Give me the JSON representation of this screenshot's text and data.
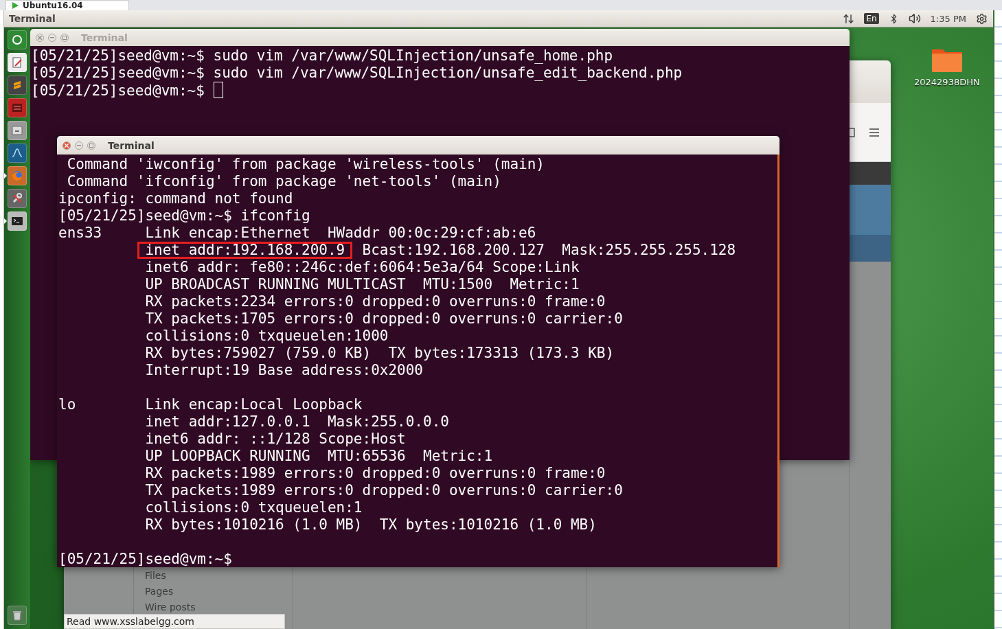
{
  "host_tab": {
    "label": "Ubuntu16.04"
  },
  "top_panel": {
    "app_title": "Terminal",
    "keyboard": "En",
    "clock": "1:35 PM"
  },
  "launcher": {
    "items": [
      {
        "kind": "home",
        "running": false
      },
      {
        "kind": "editor",
        "running": false
      },
      {
        "kind": "sublime",
        "running": false
      },
      {
        "kind": "calculator",
        "running": false
      },
      {
        "kind": "archive",
        "running": false
      },
      {
        "kind": "wave",
        "running": false
      },
      {
        "kind": "browser",
        "running": true
      },
      {
        "kind": "tools",
        "running": false
      },
      {
        "kind": "terminal",
        "running": true
      }
    ],
    "trash": {
      "kind": "trash"
    }
  },
  "desktop_icons": [
    {
      "label": "20242938DHN"
    }
  ],
  "browser": {
    "sidebar": [
      "Files",
      "Pages",
      "Wire posts"
    ],
    "status": "Read www.xsslabelgg.com"
  },
  "back_terminal": {
    "title": "Terminal",
    "focused": false,
    "cursor": true,
    "lines": [
      "[05/21/25]seed@vm:~$ sudo vim /var/www/SQLInjection/unsafe_home.php",
      "[05/21/25]seed@vm:~$ sudo vim /var/www/SQLInjection/unsafe_edit_backend.php",
      "[05/21/25]seed@vm:~$ "
    ]
  },
  "front_terminal": {
    "title": "Terminal",
    "focused": true,
    "lines": [
      {
        "kind": "plain",
        "text": " Command 'iwconfig' from package 'wireless-tools' (main)"
      },
      {
        "kind": "plain",
        "text": " Command 'ifconfig' from package 'net-tools' (main)"
      },
      {
        "kind": "plain",
        "text": "ipconfig: command not found"
      },
      {
        "kind": "plain",
        "text": "[05/21/25]seed@vm:~$ ifconfig"
      },
      {
        "kind": "plain",
        "text": "ens33     Link encap:Ethernet  HWaddr 00:0c:29:cf:ab:e6"
      },
      {
        "kind": "boxed",
        "boxed": "inet addr:192.168.200.9",
        "post": "  Bcast:192.168.200.127  Mask:255.255.255.128"
      },
      {
        "kind": "plain",
        "text": "          inet6 addr: fe80::246c:def:6064:5e3a/64 Scope:Link"
      },
      {
        "kind": "plain",
        "text": "          UP BROADCAST RUNNING MULTICAST  MTU:1500  Metric:1"
      },
      {
        "kind": "plain",
        "text": "          RX packets:2234 errors:0 dropped:0 overruns:0 frame:0"
      },
      {
        "kind": "plain",
        "text": "          TX packets:1705 errors:0 dropped:0 overruns:0 carrier:0"
      },
      {
        "kind": "plain",
        "text": "          collisions:0 txqueuelen:1000"
      },
      {
        "kind": "plain",
        "text": "          RX bytes:759027 (759.0 KB)  TX bytes:173313 (173.3 KB)"
      },
      {
        "kind": "plain",
        "text": "          Interrupt:19 Base address:0x2000"
      },
      {
        "kind": "blank"
      },
      {
        "kind": "plain",
        "text": "lo        Link encap:Local Loopback"
      },
      {
        "kind": "plain",
        "text": "          inet addr:127.0.0.1  Mask:255.0.0.0"
      },
      {
        "kind": "plain",
        "text": "          inet6 addr: ::1/128 Scope:Host"
      },
      {
        "kind": "plain",
        "text": "          UP LOOPBACK RUNNING  MTU:65536  Metric:1"
      },
      {
        "kind": "plain",
        "text": "          RX packets:1989 errors:0 dropped:0 overruns:0 frame:0"
      },
      {
        "kind": "plain",
        "text": "          TX packets:1989 errors:0 dropped:0 overruns:0 carrier:0"
      },
      {
        "kind": "plain",
        "text": "          collisions:0 txqueuelen:1"
      },
      {
        "kind": "plain",
        "text": "          RX bytes:1010216 (1.0 MB)  TX bytes:1010216 (1.0 MB)"
      },
      {
        "kind": "blank"
      },
      {
        "kind": "plain",
        "text": "[05/21/25]seed@vm:~$"
      }
    ]
  }
}
